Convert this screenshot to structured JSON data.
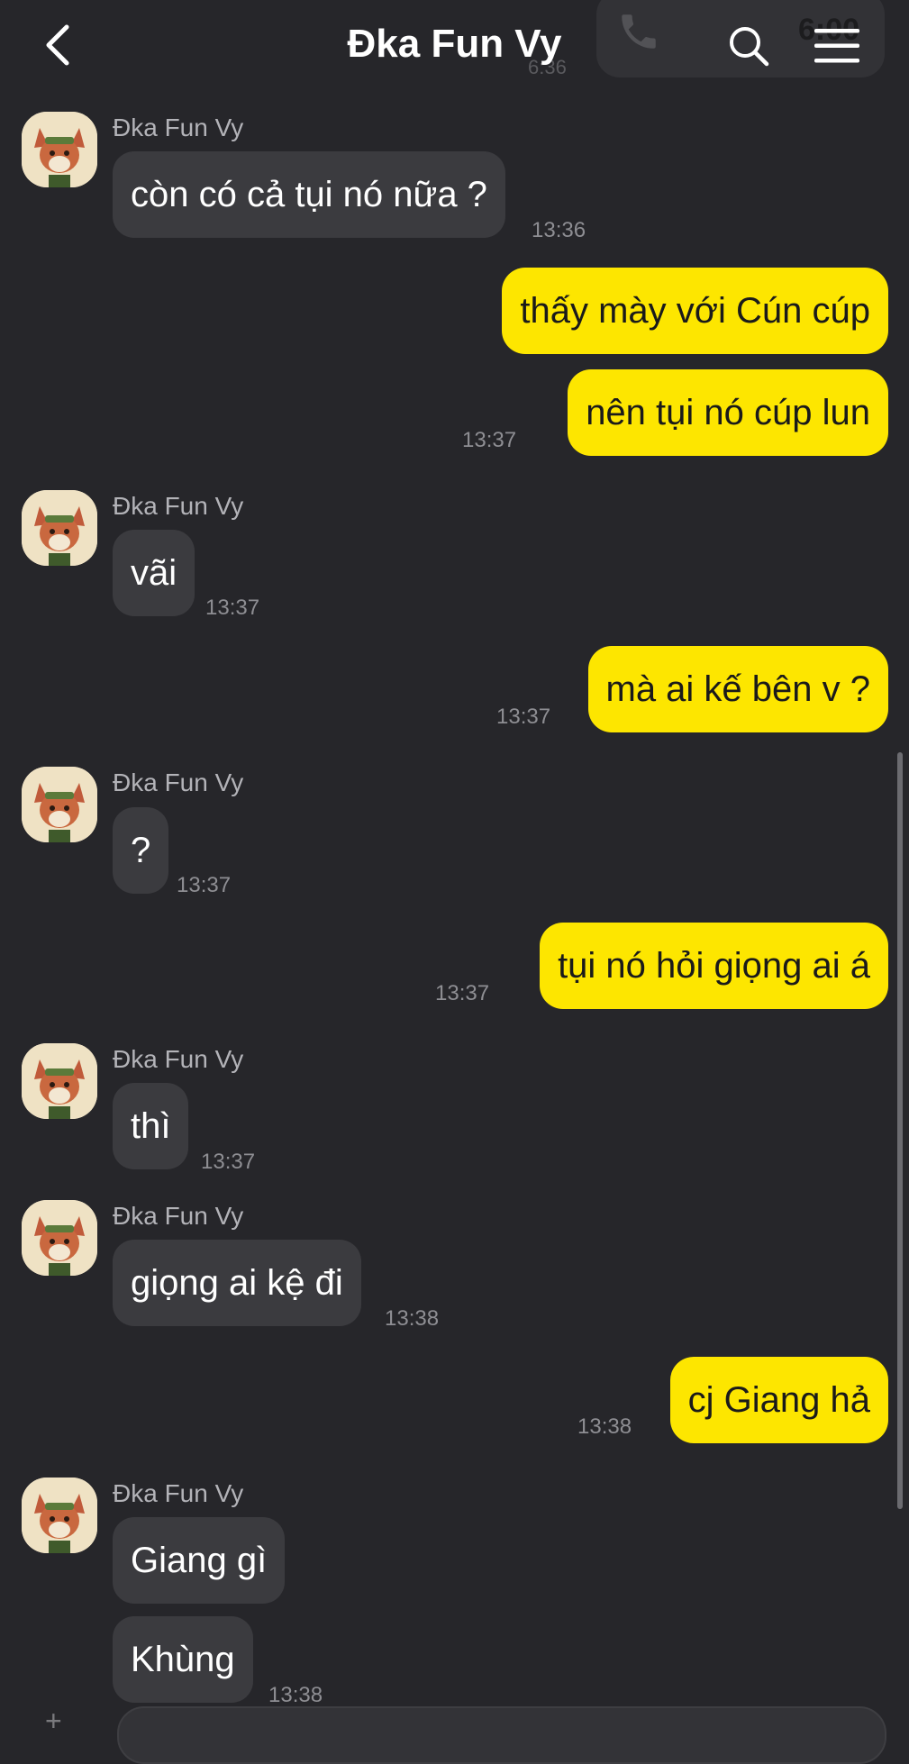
{
  "header": {
    "title": "Đka Fun Vy",
    "ghost_clock": "6:00",
    "ghost_small": "6:36"
  },
  "messages": [
    {
      "dir": "in",
      "sender": "Đka Fun Vy",
      "text": "còn có cả tụi nó nữa ?",
      "time": "13:36"
    },
    {
      "dir": "out",
      "text": "thấy mày với Cún cúp",
      "time": ""
    },
    {
      "dir": "out",
      "text": "nên tụi nó cúp lun",
      "time": "13:37"
    },
    {
      "dir": "in",
      "sender": "Đka Fun Vy",
      "text": "vãi",
      "time": "13:37"
    },
    {
      "dir": "out",
      "text": "mà ai kế bên v ?",
      "time": "13:37"
    },
    {
      "dir": "in",
      "sender": "Đka Fun Vy",
      "text": "?",
      "time": "13:37"
    },
    {
      "dir": "out",
      "text": "tụi nó hỏi giọng ai á",
      "time": "13:37"
    },
    {
      "dir": "in",
      "sender": "Đka Fun Vy",
      "text": "thì",
      "time": "13:37"
    },
    {
      "dir": "in",
      "sender": "Đka Fun Vy",
      "text": "giọng ai kệ đi",
      "time": "13:38"
    },
    {
      "dir": "out",
      "text": "cj Giang hả",
      "time": "13:38"
    },
    {
      "dir": "in",
      "sender": "Đka Fun Vy",
      "text": "Giang gì",
      "time": ""
    },
    {
      "dir": "in",
      "text": "Khùng",
      "time": "13:38"
    }
  ],
  "colors": {
    "background": "#26262a",
    "incoming_bubble": "#3b3b3f",
    "outgoing_bubble": "#fde600",
    "timestamp": "#8e8e93"
  },
  "icons": {
    "back": "chevron-left-icon",
    "search": "search-icon",
    "menu": "menu-icon",
    "avatar": "fox-avatar"
  }
}
